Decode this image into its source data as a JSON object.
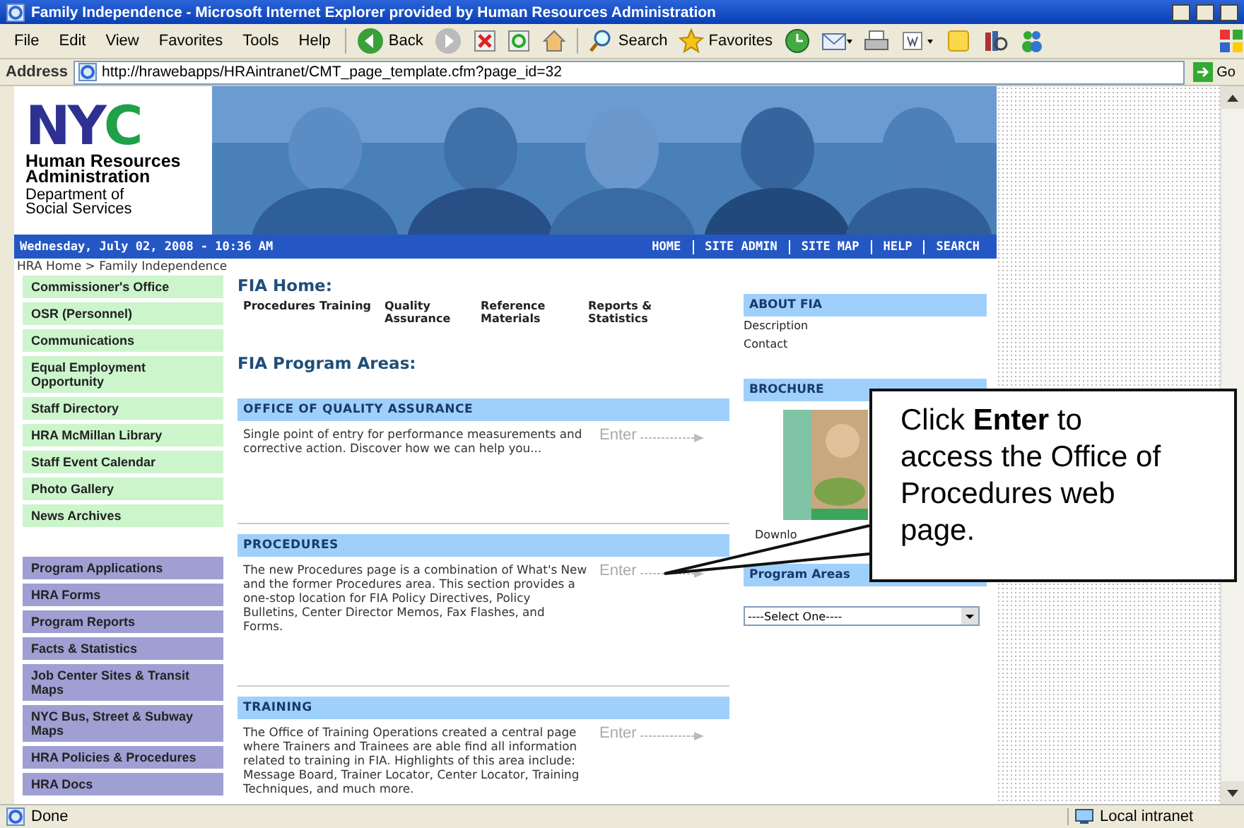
{
  "window": {
    "title": "Family Independence - Microsoft Internet Explorer provided by Human Resources Administration"
  },
  "menu": [
    "File",
    "Edit",
    "View",
    "Favorites",
    "Tools",
    "Help"
  ],
  "toolbar": [
    {
      "kind": "back",
      "label": "Back"
    },
    {
      "kind": "forward"
    },
    {
      "kind": "stop"
    },
    {
      "kind": "refresh"
    },
    {
      "kind": "home"
    },
    {
      "kind": "search",
      "label": "Search"
    },
    {
      "kind": "favorites",
      "label": "Favorites"
    },
    {
      "kind": "history"
    },
    {
      "kind": "mail"
    },
    {
      "kind": "print"
    },
    {
      "kind": "edit"
    },
    {
      "kind": "notes"
    },
    {
      "kind": "research"
    },
    {
      "kind": "messenger"
    }
  ],
  "address": {
    "label": "Address",
    "value": "http://hrawebapps/HRAintranet/CMT_page_template.cfm?page_id=32",
    "go": "Go"
  },
  "header": {
    "logo": [
      {
        "letter": "N",
        "color": "#2e3192"
      },
      {
        "letter": "Y",
        "color": "#2e3192"
      },
      {
        "letter": "C",
        "color": "#1fa049"
      }
    ],
    "org": "Human Resources Administration",
    "dept": "Department of Social Services"
  },
  "date_bar": {
    "date": "Wednesday, July 02, 2008 - 10:36 AM",
    "links": [
      "HOME",
      "SITE ADMIN",
      "SITE MAP",
      "HELP",
      "SEARCH"
    ]
  },
  "breadcrumb": "HRA Home > Family Independence",
  "sidebar": {
    "items": [
      {
        "label": "Commissioner's Office",
        "kind": "green"
      },
      {
        "label": "OSR (Personnel)",
        "kind": "green"
      },
      {
        "label": "Communications",
        "kind": "green"
      },
      {
        "label": "Equal Employment Opportunity",
        "kind": "green"
      },
      {
        "label": "Staff Directory",
        "kind": "green"
      },
      {
        "label": "HRA McMillan Library",
        "kind": "green"
      },
      {
        "label": "Staff Event Calendar",
        "kind": "green"
      },
      {
        "label": "Photo Gallery",
        "kind": "green"
      },
      {
        "label": "News Archives",
        "kind": "green"
      },
      {
        "label": "Program Applications",
        "kind": "purple"
      },
      {
        "label": "HRA Forms",
        "kind": "purple"
      },
      {
        "label": "Program Reports",
        "kind": "purple"
      },
      {
        "label": "Facts & Statistics",
        "kind": "purple"
      },
      {
        "label": "Job Center Sites & Transit Maps",
        "kind": "purple"
      },
      {
        "label": "NYC Bus, Street & Subway Maps",
        "kind": "purple"
      },
      {
        "label": "HRA Policies & Procedures",
        "kind": "purple"
      },
      {
        "label": "HRA Docs",
        "kind": "purple"
      }
    ]
  },
  "main": {
    "title": "FIA Home:",
    "links": [
      "Procedures",
      "Training",
      "Quality Assurance",
      "Reference Materials",
      "Reports & Statistics"
    ],
    "areas_title": "FIA Program Areas:",
    "sections": [
      {
        "heading": "OFFICE OF QUALITY ASSURANCE",
        "text": "Single point of entry for performance measurements and corrective action. Discover how we can help you...",
        "enter": "Enter"
      },
      {
        "heading": "PROCEDURES",
        "text": "The new Procedures page is a combination of What's New and the former Procedures area. This section provides a one-stop location for FIA Policy Directives, Policy Bulletins, Center Director Memos, Fax Flashes, and Forms.",
        "enter": "Enter"
      },
      {
        "heading": "TRAINING",
        "text": "The Office of Training Operations created a central page where Trainers and Trainees are able find all information related to training in FIA. Highlights of this area include: Message Board, Trainer Locator, Center Locator, Training Techniques, and much more.",
        "enter": "Enter"
      }
    ]
  },
  "right": {
    "about": {
      "heading": "ABOUT FIA",
      "links": [
        "Description",
        "Contact"
      ]
    },
    "brochure": {
      "heading": "BROCHURE",
      "link": "Downlo"
    },
    "program_areas": {
      "heading": "Program Areas",
      "select": "----Select One----"
    }
  },
  "callout": {
    "text": "Click **Enter** to access the Office of Procedures web page."
  },
  "status_bar": {
    "text": "Done",
    "zone": "Local intranet"
  }
}
